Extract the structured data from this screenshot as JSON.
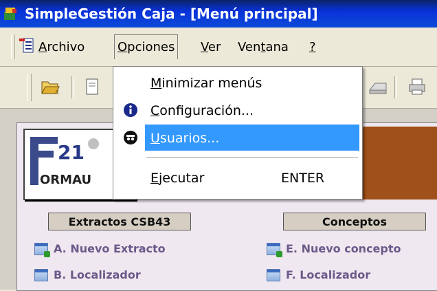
{
  "window": {
    "title": "SimpleGestión Caja - [Menú principal]"
  },
  "menubar": {
    "items": [
      {
        "label": "Archivo",
        "accel": "A",
        "rest": "rchivo"
      },
      {
        "label": "Opciones",
        "accel": "O",
        "rest": "pciones"
      },
      {
        "label": "Ver",
        "accel": "V",
        "rest": "er"
      },
      {
        "label": "Ventana",
        "pre": "Ven",
        "accel": "t",
        "rest": "ana"
      },
      {
        "label": "?",
        "accel": "?"
      }
    ]
  },
  "dropdown": {
    "items": [
      {
        "label": "Minimizar menús",
        "accel": "M",
        "rest": "inimizar menús",
        "icon": ""
      },
      {
        "label": "Configuración...",
        "accel": "C",
        "rest": "onfiguración...",
        "icon": "info-icon"
      },
      {
        "label": "Usuarios...",
        "accel": "U",
        "rest": "suarios...",
        "icon": "users-icon",
        "selected": true
      },
      {
        "label": "Ejecutar",
        "accel": "E",
        "rest": "jecutar",
        "shortcut": "ENTER"
      }
    ]
  },
  "main": {
    "sections": [
      {
        "title": "Extractos CSB43",
        "links": [
          {
            "label": "A. Nuevo Extracto"
          },
          {
            "label": "B. Localizador"
          }
        ]
      },
      {
        "title": "Conceptos",
        "links": [
          {
            "label": "E. Nuevo concepto"
          },
          {
            "label": "F. Localizador"
          }
        ]
      }
    ],
    "logo_text": "F21 FORMAU"
  },
  "colors": {
    "titlebar": "#0831d9",
    "selection": "#3399ff",
    "link": "#6a5a8a"
  }
}
